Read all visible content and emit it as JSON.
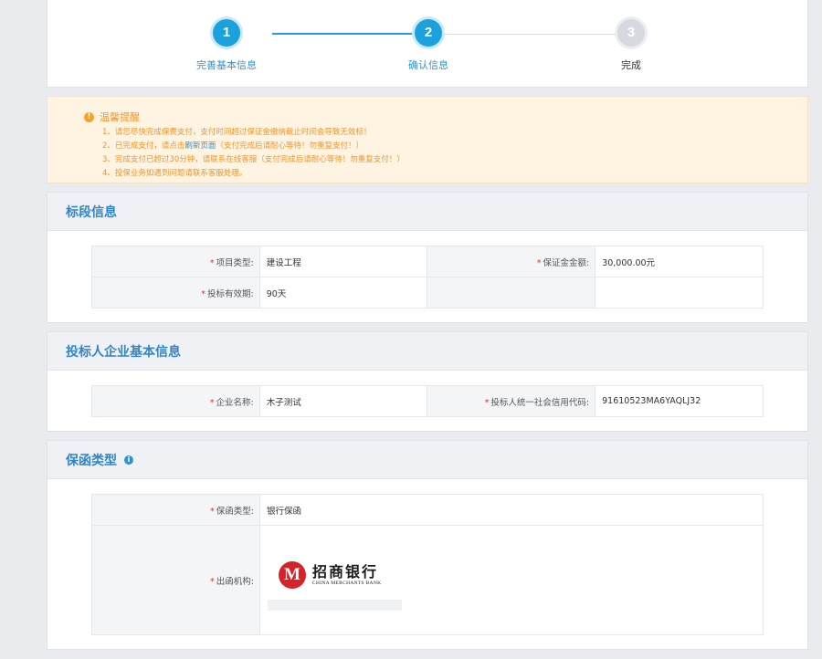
{
  "steps": [
    {
      "number": "1",
      "label": "完善基本信息",
      "state": "active"
    },
    {
      "number": "2",
      "label": "确认信息",
      "state": "active"
    },
    {
      "number": "3",
      "label": "完成",
      "state": "inactive"
    }
  ],
  "notice": {
    "title": "温馨提醒",
    "items": {
      "i1": "1、请您尽快完成保费支付，支付时间超过保证金缴纳截止时间会导致无效标！",
      "i2_prefix": "2、已完成支付，请点击",
      "i2_link": "刷新页面",
      "i2_suffix": "（支付完成后请耐心等待！勿重复支付！）",
      "i3": "3、完成支付已超过30分钟，请联系在线客服（支付完成后请耐心等待！勿重复支付！）",
      "i4": "4、投保业务如遇到问题请联系客服处理。"
    }
  },
  "section_bid": {
    "title": "标段信息",
    "project_type_label": "项目类型:",
    "project_type_value": "建设工程",
    "deposit_label": "保证金金额:",
    "deposit_value": "30,000.00元",
    "validity_label": "投标有效期:",
    "validity_value": "90天"
  },
  "section_company": {
    "title": "投标人企业基本信息",
    "name_label": "企业名称:",
    "name_value": "木子测试",
    "credit_label": "投标人统一社会信用代码:",
    "credit_value": "91610523MA6YAQLJ32"
  },
  "section_guarantee": {
    "title": "保函类型",
    "type_label": "保函类型:",
    "type_value": "银行保函",
    "issuer_label": "出函机构:",
    "bank_cn": "招商银行",
    "bank_en": "CHINA MERCHANTS BANK"
  },
  "colors": {
    "accent": "#1ba1dc",
    "title_blue": "#2f86c9",
    "warning": "#f0962d",
    "required": "#e0322e",
    "bank_red": "#d4242a"
  },
  "icons": {
    "notice": "warning-icon",
    "guarantee_info": "info-icon"
  }
}
